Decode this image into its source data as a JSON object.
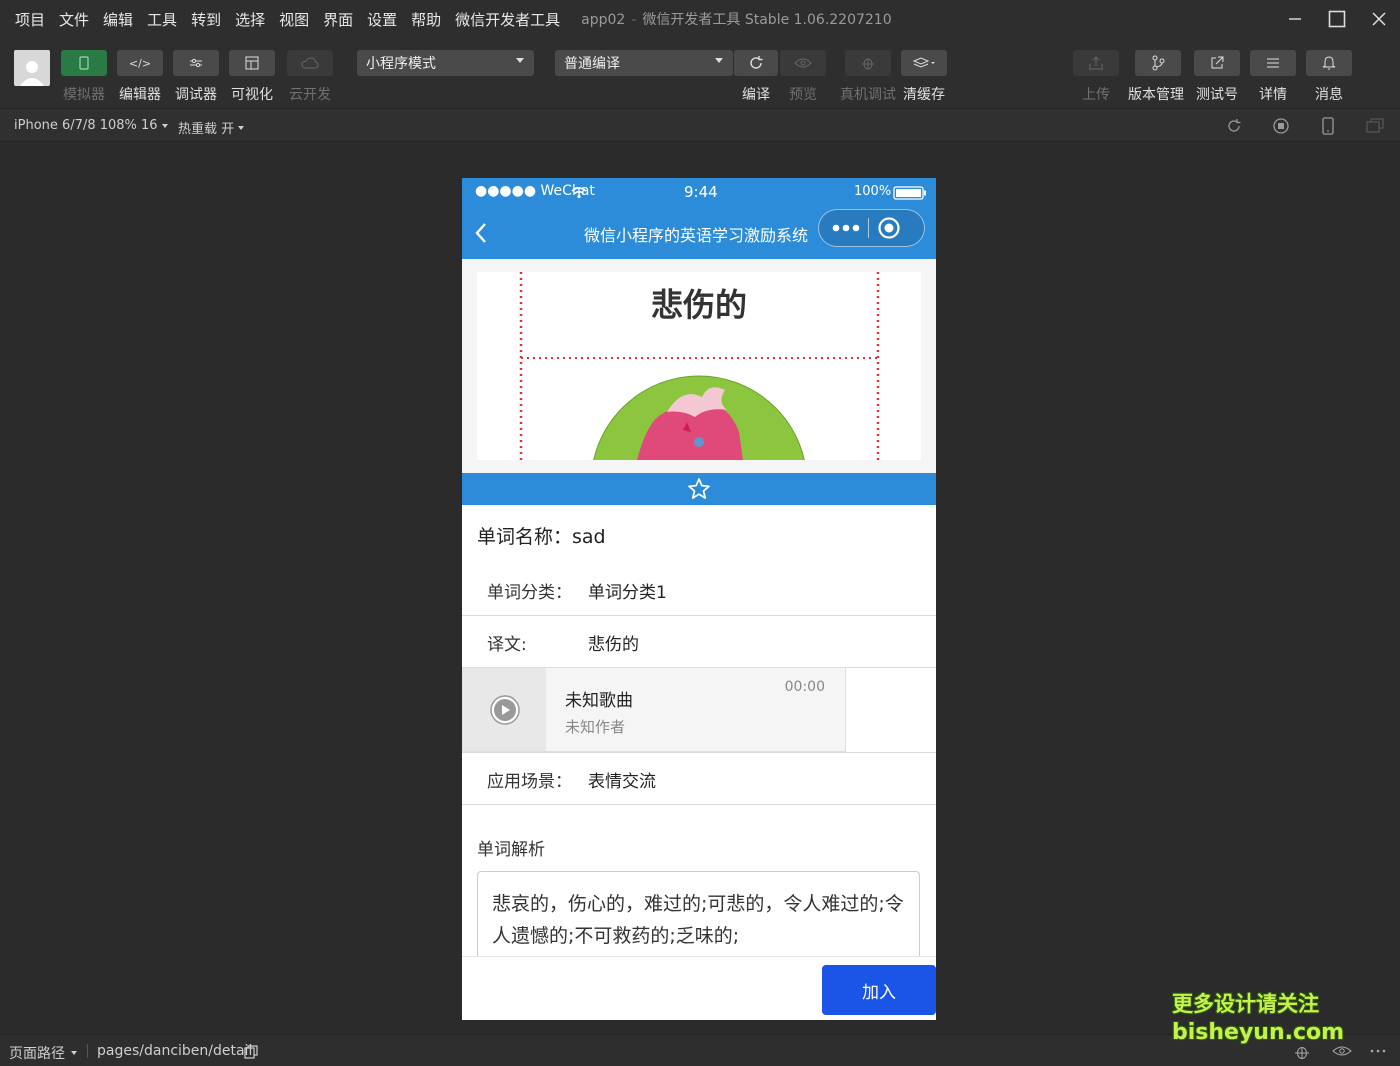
{
  "menubar": {
    "items": [
      "项目",
      "文件",
      "编辑",
      "工具",
      "转到",
      "选择",
      "视图",
      "界面",
      "设置",
      "帮助",
      "微信开发者工具"
    ],
    "project_name": "app02",
    "separator": "-",
    "app_version": "微信开发者工具 Stable 1.06.2207210"
  },
  "toolbar": {
    "left_tools": [
      {
        "label": "模拟器",
        "icon": "phone-icon",
        "state": "active-dim"
      },
      {
        "label": "编辑器",
        "icon": "code-icon"
      },
      {
        "label": "调试器",
        "icon": "debug-settings-icon"
      },
      {
        "label": "可视化",
        "icon": "layout-icon"
      },
      {
        "label": "云开发",
        "icon": "cloud-icon",
        "state": "disabled"
      }
    ],
    "mode_select": "小程序模式",
    "compile_select": "普通编译",
    "compile_label": "编译",
    "preview_label": "预览",
    "remote_debug_label": "真机调试",
    "clear_cache_label": "清缓存",
    "right_tools": [
      {
        "label": "上传",
        "icon": "upload-icon",
        "state": "disabled"
      },
      {
        "label": "版本管理",
        "icon": "branch-icon"
      },
      {
        "label": "测试号",
        "icon": "external-link-icon"
      },
      {
        "label": "详情",
        "icon": "menu-icon"
      },
      {
        "label": "消息",
        "icon": "bell-icon"
      }
    ]
  },
  "subbar": {
    "device": "iPhone 6/7/8 108% 16",
    "hot_reload": "热重载 开"
  },
  "phone": {
    "status": {
      "carrier": "●●●●● WeChat",
      "time": "9:44",
      "battery": "100%"
    },
    "nav_title": "微信小程序的英语学习激励系统",
    "banner_word": "悲伤的",
    "word_name_label": "单词名称：",
    "word_name": "sad",
    "category_label": "单词分类：",
    "category": "单词分类1",
    "translation_label": "译文:",
    "translation": "悲伤的",
    "audio": {
      "song": "未知歌曲",
      "artist": "未知作者",
      "time": "00:00"
    },
    "scene_label": "应用场景：",
    "scene": "表情交流",
    "analysis_label": "单词解析",
    "analysis_text": "悲哀的，伤心的，难过的;可悲的，令人难过的;令人遗憾的;不可救药的;乏味的;",
    "join_button": "加入"
  },
  "footer": {
    "path_label": "页面路径",
    "path": "pages/danciben/detail"
  },
  "watermark": {
    "line1": "更多设计请关注",
    "line2": "bisheyun.com"
  },
  "colors": {
    "accent_blue": "#2d8cd9",
    "join_button": "#1a55e8",
    "active_green": "#2a7a45",
    "ide_background": "#2b2b2b"
  }
}
